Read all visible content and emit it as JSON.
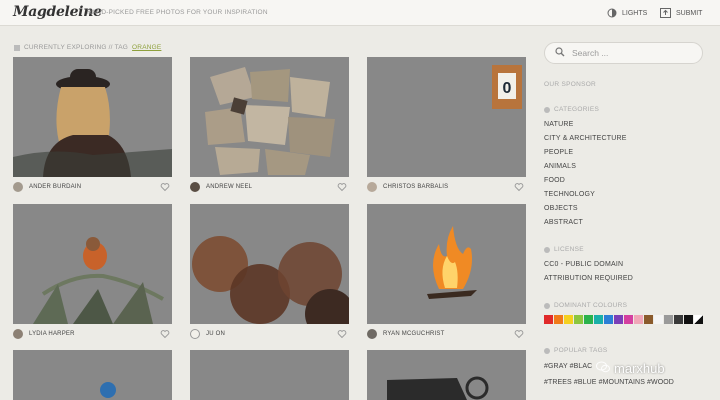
{
  "header": {
    "logo": "Magdeleine",
    "tagline": "HAND-PICKED FREE PHOTOS FOR YOUR INSPIRATION",
    "lights_label": "LIGHTS",
    "submit_label": "SUBMIT"
  },
  "breadcrumb": {
    "prefix": "CURRENTLY EXPLORING // TAG",
    "tag": "ORANGE"
  },
  "photos": [
    {
      "author": "ANDER BURDAIN",
      "icon": "heart-icon"
    },
    {
      "author": "ANDREW NEEL",
      "icon": "heart-icon"
    },
    {
      "author": "CHRISTOS BARBALIS",
      "icon": "heart-icon"
    },
    {
      "author": "LYDIA HARPER",
      "icon": "heart-icon"
    },
    {
      "author": "JU ON",
      "icon": "heart-icon"
    },
    {
      "author": "RYAN MCGUCHRIST",
      "icon": "heart-icon"
    }
  ],
  "sidebar": {
    "search_placeholder": "Search ...",
    "sponsor_label": "OUR SPONSOR",
    "categories_title": "CATEGORIES",
    "categories": [
      "NATURE",
      "CITY & ARCHITECTURE",
      "PEOPLE",
      "ANIMALS",
      "FOOD",
      "TECHNOLOGY",
      "OBJECTS",
      "ABSTRACT"
    ],
    "license_title": "LICENSE",
    "licenses": [
      "CC0 - PUBLIC DOMAIN",
      "ATTRIBUTION REQUIRED"
    ],
    "colours_title": "DOMINANT COLOURS",
    "colours": [
      "#e02a2a",
      "#f07a1a",
      "#f5d020",
      "#8cc63f",
      "#2bb24c",
      "#1ab0a8",
      "#2c7fd6",
      "#7b3fb8",
      "#d43fa0",
      "#f0a6b8",
      "#8a5a2c",
      "#f4f4f4",
      "#9a9a9a",
      "#3a3a3a",
      "#111111"
    ],
    "tags_title": "POPULAR TAGS",
    "tags_line1": "#GRAY #BLAC",
    "tags_line2": "#TREES #BLUE #MOUNTAINS #WOOD"
  },
  "watermark": "marxhub"
}
